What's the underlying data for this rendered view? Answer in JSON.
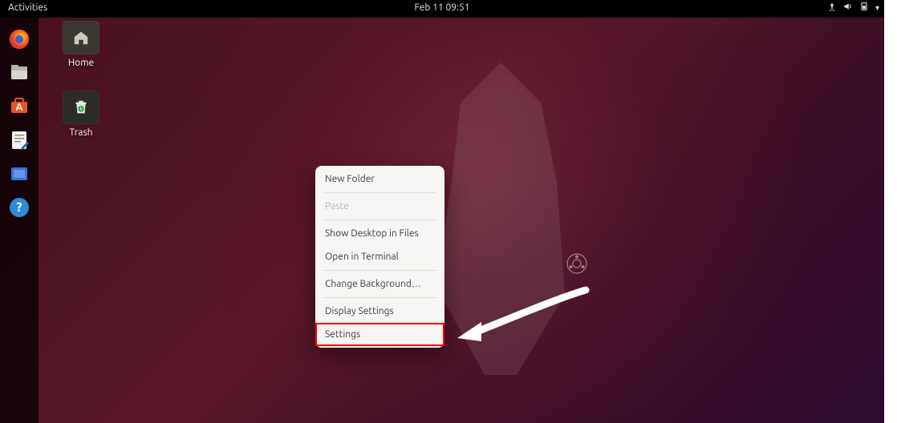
{
  "topbar": {
    "activities_label": "Activities",
    "datetime": "Feb 11  09:51"
  },
  "dock": {
    "items": [
      {
        "name": "firefox"
      },
      {
        "name": "files"
      },
      {
        "name": "software"
      },
      {
        "name": "text-editor"
      },
      {
        "name": "tweaks"
      },
      {
        "name": "help"
      }
    ]
  },
  "desktop": {
    "icons": [
      {
        "name": "home",
        "label": "Home"
      },
      {
        "name": "trash",
        "label": "Trash"
      }
    ]
  },
  "context_menu": {
    "items": [
      {
        "label": "New Folder",
        "enabled": true,
        "highlighted": false
      },
      {
        "label": "Paste",
        "enabled": false,
        "highlighted": false
      },
      {
        "label": "Show Desktop in Files",
        "enabled": true,
        "highlighted": false
      },
      {
        "label": "Open in Terminal",
        "enabled": true,
        "highlighted": false
      },
      {
        "label": "Change Background…",
        "enabled": true,
        "highlighted": false
      },
      {
        "label": "Display Settings",
        "enabled": true,
        "highlighted": false
      },
      {
        "label": "Settings",
        "enabled": true,
        "highlighted": true
      }
    ]
  },
  "colors": {
    "highlight_box": "#ff0000",
    "annotation_arrow": "#ffffff"
  }
}
